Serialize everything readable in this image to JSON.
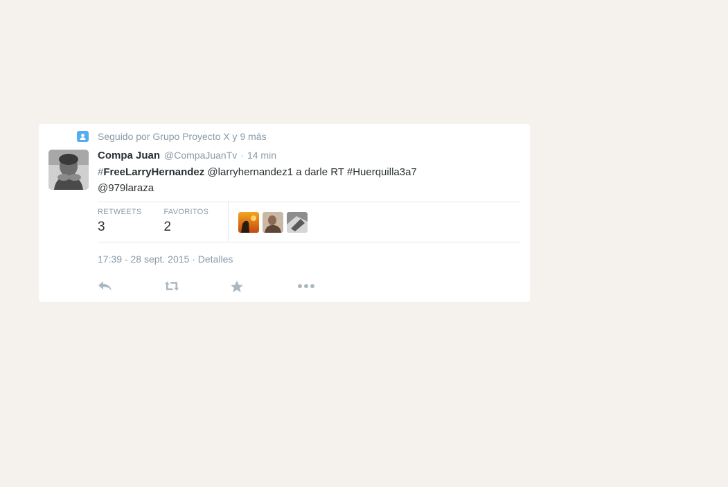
{
  "context": {
    "text": "Seguido por Grupo Proyecto X y 9 más",
    "icon": "person-icon"
  },
  "tweet": {
    "fullname": "Compa Juan",
    "username": "@CompaJuanTv",
    "separator": "·",
    "time": "14 min",
    "text": {
      "hash_symbol": "#",
      "hashtag": "FreeLarryHernandez",
      "line1_rest": " @larryhernandez1 a darle RT #Huerquilla3a7",
      "line2": "@979laraza"
    },
    "stats": {
      "retweets_label": "RETWEETS",
      "retweets_value": "3",
      "favorites_label": "FAVORITOS",
      "favorites_value": "2"
    },
    "timestamp": "17:39 - 28 sept. 2015",
    "details_separator": "·",
    "details_link": "Detalles",
    "actions": [
      "reply-icon",
      "retweet-icon",
      "favorite-icon",
      "more-icon"
    ]
  },
  "colors": {
    "background": "#f5f2ed",
    "accent": "#55acee",
    "muted": "#8899a6",
    "text": "#292f33",
    "icon": "#aab8c2"
  }
}
